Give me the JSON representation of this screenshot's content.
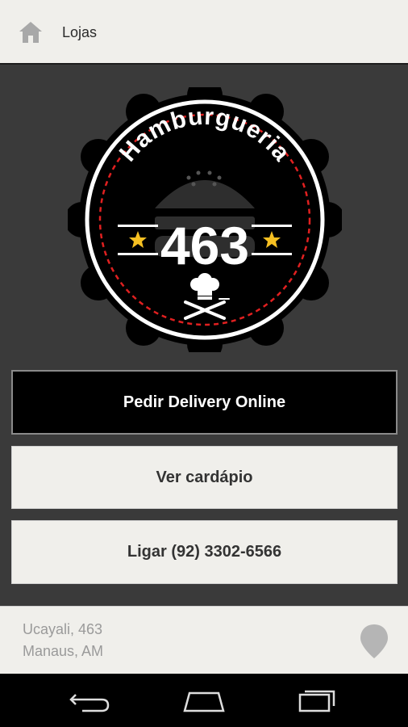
{
  "topbar": {
    "title": "Lojas",
    "home_icon": "home-icon"
  },
  "logo": {
    "brand_text": "Hamburgueria",
    "number": "463",
    "colors": {
      "badge": "#000000",
      "ring": "#ffffff",
      "dash": "#e02020",
      "star": "#f6c022"
    }
  },
  "buttons": {
    "delivery": "Pedir Delivery Online",
    "menu": "Ver cardápio",
    "call": "Ligar (92) 3302-6566"
  },
  "footer": {
    "address_line1": "Ucayali, 463",
    "address_line2": "Manaus, AM",
    "location_icon": "map-pin-icon"
  },
  "navbar": {
    "icons": [
      "back-icon",
      "home-icon",
      "recent-apps-icon"
    ]
  }
}
